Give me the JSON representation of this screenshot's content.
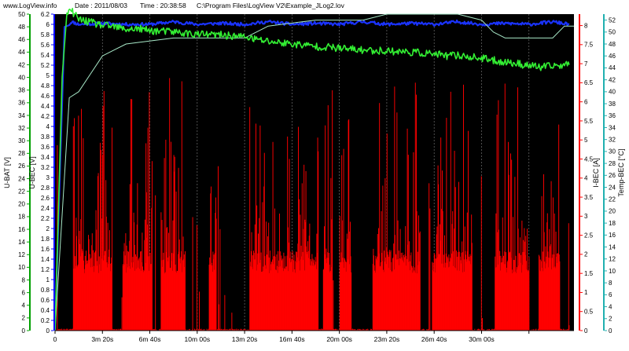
{
  "header": {
    "site": "www.LogView.info",
    "date": "Date : 2011/08/03",
    "time": "Time : 20:38:58",
    "file": "C:\\Program Files\\LogView V2\\Example_JLog2.lov"
  },
  "axes": {
    "u_bat": {
      "label": "U-BAT [V]",
      "color": "#00a000",
      "range": [
        0,
        50
      ],
      "ticks": [
        0,
        2,
        4,
        6,
        8,
        10,
        12,
        14,
        16,
        18,
        20,
        22,
        24,
        26,
        28,
        30,
        32,
        34,
        36,
        38,
        40,
        42,
        44,
        46,
        48,
        50
      ],
      "tick_labels": [
        "0",
        "2",
        "4",
        "6",
        "8",
        "10",
        "12",
        "14",
        "16",
        "18",
        "20",
        "22",
        "24",
        "26",
        "28",
        "30",
        "32",
        "34",
        "36",
        "38",
        "40",
        "42",
        "44",
        "46",
        "48",
        "50"
      ]
    },
    "u_bec": {
      "label": "U-BEC [V]",
      "color": "#0000ff",
      "range": [
        0,
        6.2
      ],
      "ticks": [
        0,
        0.2,
        0.4,
        0.6,
        0.8,
        1,
        1.2,
        1.4,
        1.6,
        1.8,
        2,
        2.2,
        2.4,
        2.6,
        2.8,
        3,
        3.2,
        3.4,
        3.6,
        3.8,
        4,
        4.2,
        4.4,
        4.6,
        4.8,
        5,
        5.2,
        5.4,
        5.6,
        5.8,
        6,
        6.2
      ],
      "tick_labels": [
        "0",
        "0.2",
        "0.4",
        "0.6",
        "0.8",
        "1",
        "1.2",
        "1.4",
        "1.6",
        "1.8",
        "2",
        "2.2",
        "2.4",
        "2.6",
        "2.8",
        "3",
        "3.2",
        "3.4",
        "3.6",
        "3.8",
        "4",
        "4.2",
        "4.4",
        "4.6",
        "4.8",
        "5",
        "5.2",
        "5.4",
        "5.6",
        "5.8",
        "6",
        "6.2"
      ]
    },
    "i_bec": {
      "label": "I-BEC [A]",
      "color": "#ff0000",
      "range": [
        0,
        8.3
      ],
      "ticks": [
        0,
        0.5,
        1,
        1.5,
        2,
        2.5,
        3,
        3.5,
        4,
        4.5,
        5,
        5.5,
        6,
        6.5,
        7,
        7.5,
        8
      ],
      "tick_labels": [
        "0",
        "0.5",
        "1",
        "1.5",
        "2",
        "2.5",
        "3",
        "3.5",
        "4",
        "4.5",
        "5",
        "5.5",
        "6",
        "6.5",
        "7",
        "7.5",
        "8"
      ]
    },
    "temp_bec": {
      "label": "Temp-BEC [°C]",
      "color": "#20b0b0",
      "range": [
        0,
        53
      ],
      "ticks": [
        0,
        2,
        4,
        6,
        8,
        10,
        12,
        14,
        16,
        18,
        20,
        22,
        24,
        26,
        28,
        30,
        32,
        34,
        36,
        38,
        40,
        42,
        44,
        46,
        48,
        50,
        52
      ],
      "tick_labels": [
        "0",
        "2",
        "4",
        "6",
        "8",
        "10",
        "12",
        "14",
        "16",
        "18",
        "20",
        "22",
        "24",
        "26",
        "28",
        "30",
        "32",
        "34",
        "36",
        "38",
        "40",
        "42",
        "44",
        "46",
        "48",
        "50",
        "52"
      ]
    },
    "time": {
      "range": [
        0,
        2190
      ],
      "ticks": [
        0,
        200,
        400,
        600,
        800,
        1000,
        1200,
        1400,
        1600,
        1800,
        2000
      ],
      "tick_labels": [
        "0",
        "3m 20s",
        "6m 40s",
        "10m 00s",
        "13m 20s",
        "16m 40s",
        "20m 00s",
        "23m 20s",
        "26m 40s",
        "30m 00s"
      ]
    }
  },
  "colors": {
    "plot_bg": "#000000",
    "u_bec": "#0000ff",
    "u_bec_dense": "#1a33ff",
    "i_bec": "#ff0000",
    "u_bat": "#33ee33",
    "temp": "#a8e8c8",
    "frame": "#20b0b0",
    "grid": "#707070"
  },
  "chart_data": {
    "type": "line",
    "x_unit": "s",
    "x_range": [
      0,
      2190
    ],
    "grid": "vertical dashed",
    "series": [
      {
        "name": "U-BEC [V]",
        "axis": "u_bec",
        "points": [
          [
            0,
            0
          ],
          [
            20,
            3
          ],
          [
            40,
            5.95
          ],
          [
            60,
            6
          ],
          [
            70,
            6.05
          ],
          [
            100,
            6.0
          ],
          [
            200,
            6.02
          ],
          [
            300,
            6.0
          ],
          [
            400,
            6.0
          ],
          [
            500,
            6.05
          ],
          [
            600,
            6.0
          ],
          [
            700,
            6.02
          ],
          [
            800,
            6.0
          ],
          [
            900,
            6.05
          ],
          [
            1000,
            6.0
          ],
          [
            1100,
            6.02
          ],
          [
            1200,
            6.0
          ],
          [
            1300,
            6.05
          ],
          [
            1400,
            6.0
          ],
          [
            1500,
            6.02
          ],
          [
            1600,
            6.0
          ],
          [
            1700,
            6.05
          ],
          [
            1800,
            6.0
          ],
          [
            1900,
            6.02
          ],
          [
            2000,
            6.0
          ],
          [
            2100,
            6.05
          ],
          [
            2170,
            6.0
          ]
        ]
      },
      {
        "name": "U-BAT [V]",
        "axis": "u_bat",
        "points": [
          [
            0,
            0
          ],
          [
            15,
            20
          ],
          [
            30,
            40
          ],
          [
            50,
            50
          ],
          [
            70,
            50.5
          ],
          [
            100,
            49.2
          ],
          [
            150,
            48.7
          ],
          [
            200,
            48.2
          ],
          [
            250,
            48.0
          ],
          [
            300,
            47.6
          ],
          [
            350,
            47.7
          ],
          [
            400,
            47.4
          ],
          [
            450,
            47.3
          ],
          [
            500,
            47.2
          ],
          [
            600,
            46.8
          ],
          [
            700,
            46.7
          ],
          [
            800,
            46.4
          ],
          [
            850,
            46.0
          ],
          [
            900,
            45.7
          ],
          [
            950,
            45.5
          ],
          [
            1000,
            45.3
          ],
          [
            1050,
            45.1
          ],
          [
            1100,
            44.9
          ],
          [
            1150,
            44.8
          ],
          [
            1200,
            44.6
          ],
          [
            1300,
            44.3
          ],
          [
            1400,
            44.2
          ],
          [
            1500,
            44.0
          ],
          [
            1600,
            43.7
          ],
          [
            1650,
            43.4
          ],
          [
            1700,
            43.5
          ],
          [
            1800,
            43.0
          ],
          [
            1850,
            42.7
          ],
          [
            1900,
            42.4
          ],
          [
            1950,
            42.2
          ],
          [
            2000,
            41.9
          ],
          [
            2050,
            41.6
          ],
          [
            2100,
            41.8
          ],
          [
            2150,
            42.0
          ],
          [
            2170,
            42.0
          ]
        ]
      },
      {
        "name": "Temp-BEC [°C]",
        "axis": "temp_bec",
        "points": [
          [
            0,
            0
          ],
          [
            40,
            26
          ],
          [
            60,
            39
          ],
          [
            100,
            40
          ],
          [
            150,
            43
          ],
          [
            200,
            46
          ],
          [
            250,
            47
          ],
          [
            300,
            48
          ],
          [
            500,
            49
          ],
          [
            700,
            49
          ],
          [
            800,
            49
          ],
          [
            900,
            51
          ],
          [
            1100,
            52
          ],
          [
            1300,
            52
          ],
          [
            1400,
            53
          ],
          [
            1500,
            53
          ],
          [
            1700,
            53
          ],
          [
            1800,
            52
          ],
          [
            1850,
            50
          ],
          [
            1900,
            49
          ],
          [
            2000,
            49
          ],
          [
            2100,
            49
          ],
          [
            2150,
            51
          ],
          [
            2190,
            51
          ]
        ]
      },
      {
        "name": "I-BEC [A]",
        "axis": "i_bec",
        "kind": "bars",
        "generator": {
          "seed": 7,
          "bins": 1100,
          "active_base": [
            1.5,
            2.1
          ],
          "idle_base": [
            0,
            0.05
          ],
          "spike_max": 6.7,
          "active_segments": [
            [
              75,
              240
            ],
            [
              285,
              410
            ],
            [
              445,
              550
            ],
            [
              650,
              680
            ],
            [
              820,
              1110
            ],
            [
              1130,
              1170
            ],
            [
              1200,
              1250
            ],
            [
              1340,
              1540
            ],
            [
              1590,
              1760
            ],
            [
              1855,
              2000
            ],
            [
              2040,
              2130
            ]
          ]
        }
      }
    ]
  }
}
